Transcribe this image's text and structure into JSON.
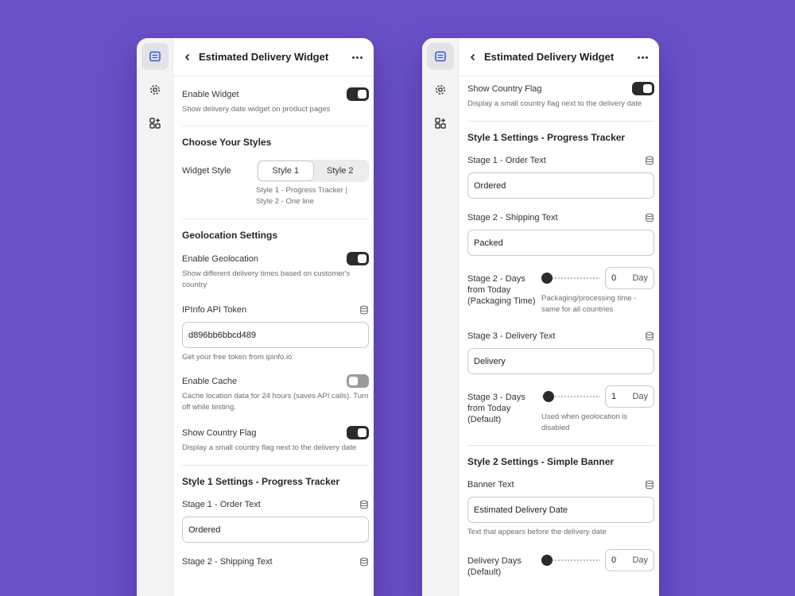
{
  "colors": {
    "background": "#6a50c8",
    "toggle_on": "#2b2b2b",
    "toggle_off": "#9b9b9e"
  },
  "icons": {
    "rail_1": "calendar-list-icon",
    "rail_2": "gear-icon",
    "rail_3": "apps-add-icon",
    "field": "database-icon"
  },
  "header": {
    "title": "Estimated Delivery Widget"
  },
  "left": {
    "enable_widget": {
      "label": "Enable Widget",
      "hint": "Show delivery date widget on product pages",
      "on": true
    },
    "styles": {
      "title": "Choose Your Styles",
      "widget_style_label": "Widget Style",
      "option1": "Style 1",
      "option2": "Style 2",
      "selected": "Style 1",
      "hint1": "Style 1 - Progress Tracker |",
      "hint2": "Style 2 - One line"
    },
    "geo": {
      "title": "Geolocation Settings",
      "enable_label": "Enable Geolocation",
      "enable_hint": "Show different delivery times based on customer's country",
      "enable_on": true,
      "token_label": "IPInfo API Token",
      "token_value": "d896bb6bbcd489",
      "token_hint": "Get your free token from ipinfo.io",
      "cache_label": "Enable Cache",
      "cache_hint": "Cache location data for 24 hours (saves API calls). Turn off while testing.",
      "cache_on": false,
      "flag_label": "Show Country Flag",
      "flag_hint": "Display a small country flag next to the delivery date",
      "flag_on": true
    },
    "style1": {
      "title": "Style 1 Settings - Progress Tracker",
      "stage1_label": "Stage 1 - Order Text",
      "stage1_value": "Ordered",
      "stage2_label": "Stage 2 - Shipping Text"
    }
  },
  "right": {
    "flag": {
      "label": "Show Country Flag",
      "hint": "Display a small country flag next to the delivery date",
      "on": true
    },
    "style1": {
      "title": "Style 1 Settings - Progress Tracker",
      "stage1_label": "Stage 1 - Order Text",
      "stage1_value": "Ordered",
      "stage2_label": "Stage 2 - Shipping Text",
      "stage2_value": "Packed",
      "stage2_days_label": "Stage 2 - Days from Today (Packaging Time)",
      "stage2_days_value": "0",
      "stage2_days_unit": "Day",
      "stage2_days_hint": "Packaging/processing time - same for all countries",
      "stage3_label": "Stage 3 - Delivery Text",
      "stage3_value": "Delivery",
      "stage3_days_label": "Stage 3 - Days from Today (Default)",
      "stage3_days_value": "1",
      "stage3_days_unit": "Day",
      "stage3_days_hint": "Used when geolocation is disabled"
    },
    "style2": {
      "title": "Style 2 Settings - Simple Banner",
      "banner_label": "Banner Text",
      "banner_value": "Estimated Delivery Date",
      "banner_hint": "Text that appears before the delivery date",
      "days_label": "Delivery Days (Default)",
      "days_value": "0",
      "days_unit": "Day"
    }
  }
}
